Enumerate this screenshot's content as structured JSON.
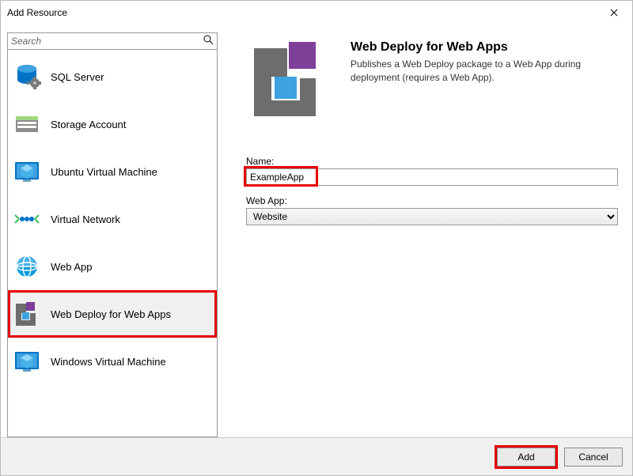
{
  "window": {
    "title": "Add Resource"
  },
  "search": {
    "placeholder": "Search"
  },
  "resources": {
    "items": [
      {
        "id": "sql-server",
        "label": "SQL Server"
      },
      {
        "id": "storage-account",
        "label": "Storage Account"
      },
      {
        "id": "ubuntu-vm",
        "label": "Ubuntu Virtual Machine"
      },
      {
        "id": "virtual-network",
        "label": "Virtual Network"
      },
      {
        "id": "web-app",
        "label": "Web App"
      },
      {
        "id": "web-deploy",
        "label": "Web Deploy for Web Apps"
      },
      {
        "id": "windows-vm",
        "label": "Windows Virtual Machine"
      }
    ],
    "selected_id": "web-deploy"
  },
  "details": {
    "title": "Web Deploy for Web Apps",
    "description": "Publishes a Web Deploy package to a Web App during deployment (requires a Web App).",
    "name_label": "Name:",
    "name_value": "ExampleApp",
    "webapp_label": "Web App:",
    "webapp_value": "Website"
  },
  "footer": {
    "add_label": "Add",
    "cancel_label": "Cancel"
  }
}
